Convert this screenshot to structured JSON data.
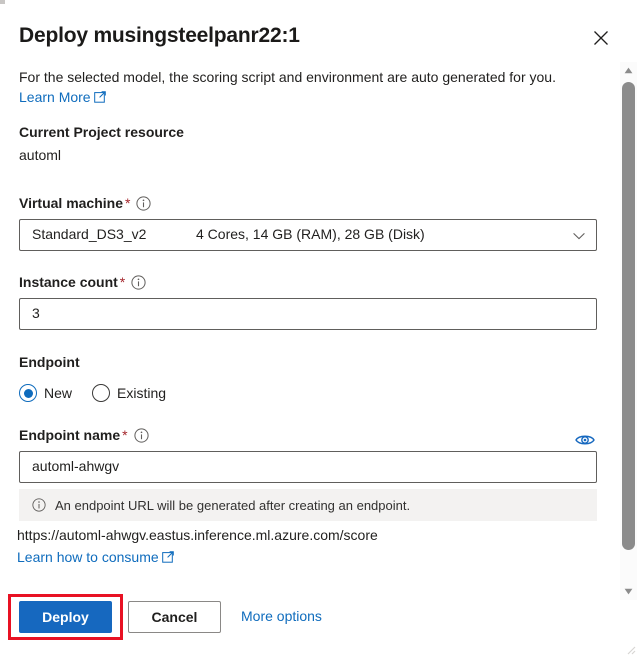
{
  "header": {
    "title": "Deploy musingsteelpanr22:1",
    "close_icon": "close-icon"
  },
  "body": {
    "description": "For the selected model, the scoring script and environment are auto generated for you.",
    "learn_more_label": "Learn More",
    "external_link_icon": "external-link-icon"
  },
  "current_project": {
    "label": "Current Project resource",
    "value": "automl"
  },
  "virtual_machine": {
    "label": "Virtual machine",
    "required_marker": "*",
    "info_icon": "info-icon",
    "selected_name": "Standard_DS3_v2",
    "selected_specs": "4 Cores, 14 GB (RAM), 28 GB (Disk)",
    "chevron_icon": "chevron-down-icon"
  },
  "instance_count": {
    "label": "Instance count",
    "required_marker": "*",
    "info_icon": "info-icon",
    "value": "3"
  },
  "endpoint": {
    "label": "Endpoint",
    "options": [
      {
        "label": "New",
        "selected": true
      },
      {
        "label": "Existing",
        "selected": false
      }
    ]
  },
  "endpoint_name": {
    "label": "Endpoint name",
    "required_marker": "*",
    "info_icon": "info-icon",
    "eye_icon": "eye-visibility-icon",
    "value": "automl-ahwgv"
  },
  "message_bar": {
    "icon": "info-icon",
    "text": "An endpoint URL will be generated after creating an endpoint."
  },
  "endpoint_url": {
    "url": "https://automl-ahwgv.eastus.inference.ml.azure.com/score",
    "consume_link_label": "Learn how to consume",
    "external_link_icon": "external-link-icon"
  },
  "footer": {
    "deploy_label": "Deploy",
    "cancel_label": "Cancel",
    "more_options_label": "More options"
  },
  "scrollbar": {
    "up_arrow_icon": "caret-up-icon",
    "down_arrow_icon": "caret-down-icon"
  },
  "colors": {
    "accent_blue": "#0f6cbd",
    "primary_button": "#1668bf",
    "required_red": "#a4262c",
    "highlight_red": "#e81123",
    "message_bar_bg": "#f3f2f1"
  }
}
